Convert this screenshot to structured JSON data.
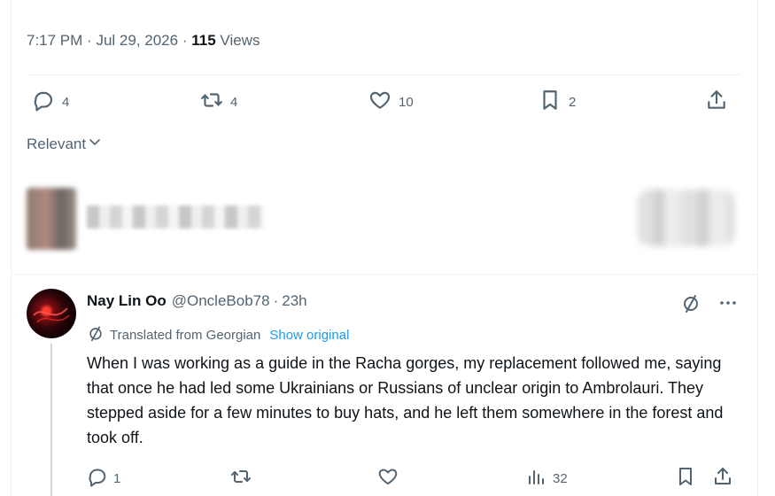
{
  "tweet": {
    "partial_text": "",
    "time": "7:17 PM",
    "date": "Jul 29, 2026",
    "views_count": "115",
    "views_label": "Views",
    "meta_dot": "·",
    "actions": {
      "replies": "4",
      "retweets": "4",
      "likes": "10",
      "bookmarks": "2"
    }
  },
  "sort": {
    "label": "Relevant"
  },
  "reply": {
    "name": "Nay Lin Oo",
    "handle": "@OncleBob78",
    "dot": "·",
    "time": "23h",
    "translated_label": "Translated from Georgian",
    "show_original": "Show original",
    "body": "When I was working as a guide in the Racha gorges, my replacement followed me, saying that once he had led some Ukrainians or Russians of unclear origin to Ambrolauri. They stepped aside for a few minutes to buy hats, and he left them somewhere in the forest and took off.",
    "actions": {
      "replies": "1",
      "retweets": "",
      "likes": "",
      "views": "32"
    }
  },
  "icons": {
    "reply": "speech-bubble-icon",
    "retweet": "retweet-icon",
    "like": "heart-icon",
    "bookmark": "bookmark-icon",
    "share": "share-icon",
    "views": "bar-chart-icon",
    "translate": "translate-icon",
    "more": "more-icon",
    "chevron": "chevron-down-icon"
  },
  "colors": {
    "link": "#1d9bf0",
    "muted": "#536471",
    "text": "#0f1419",
    "border": "#eff3f4"
  }
}
